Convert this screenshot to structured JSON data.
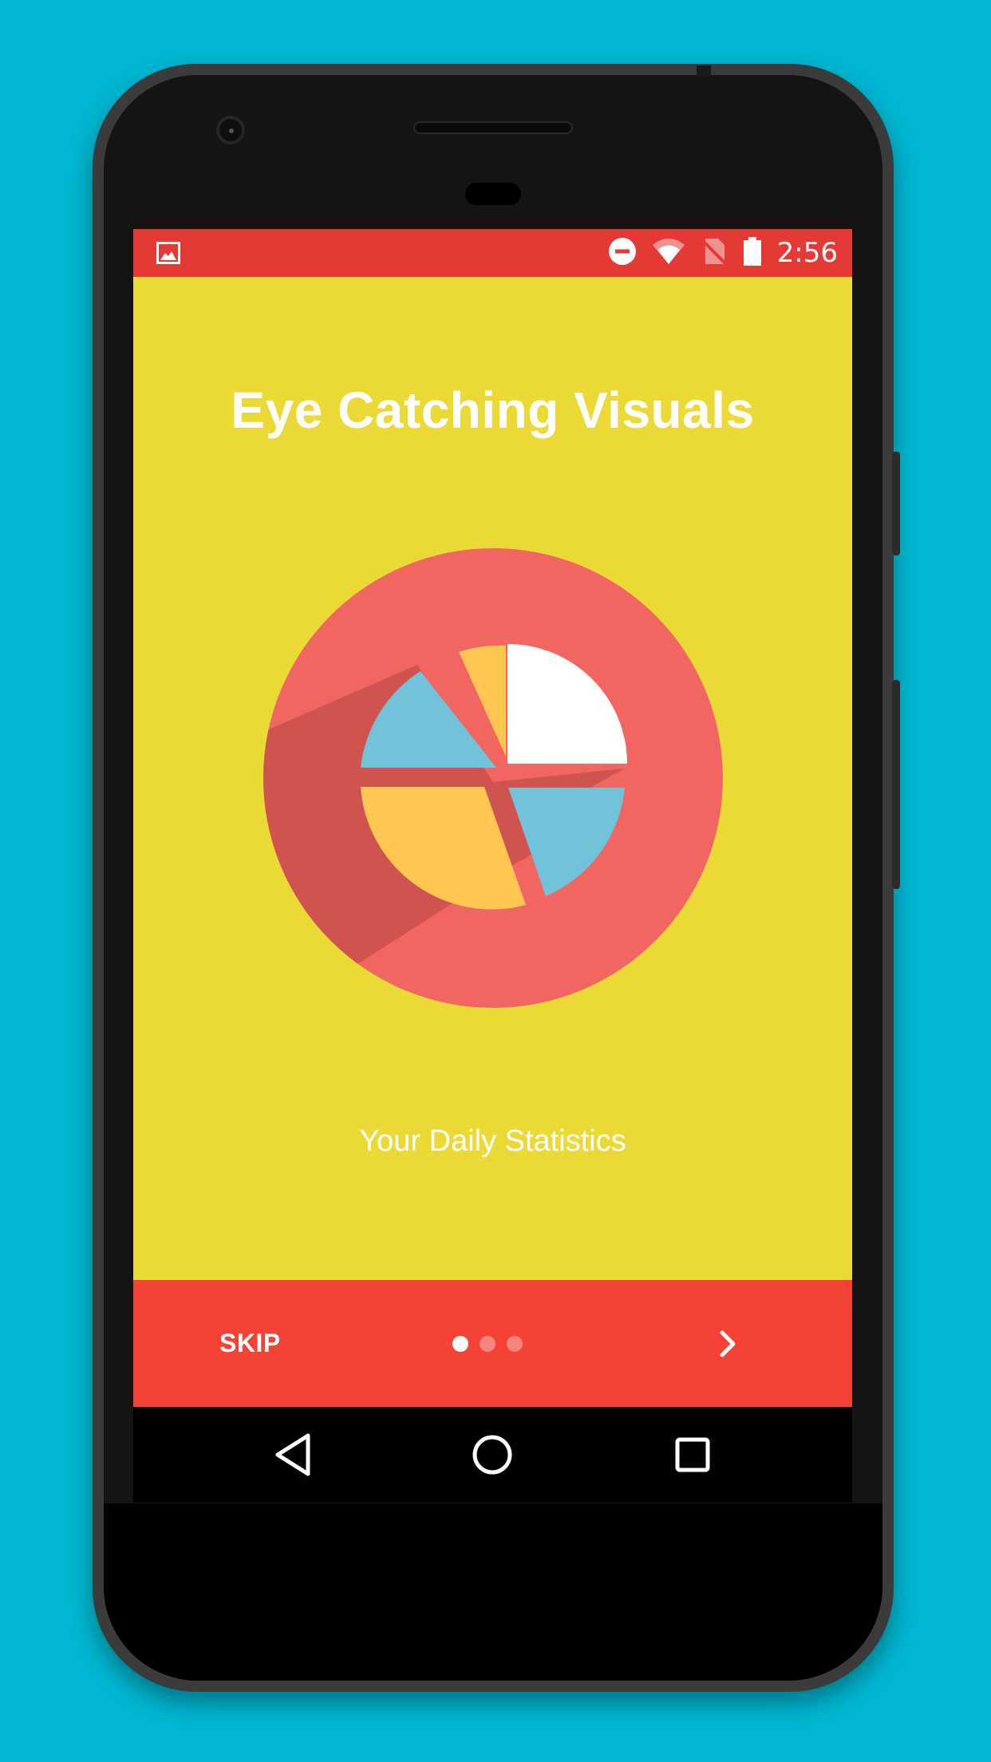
{
  "status_bar": {
    "time": "2:56",
    "left_icon": "image-icon",
    "right_icons": [
      "do-not-disturb-icon",
      "wifi-icon",
      "no-sim-icon",
      "battery-icon"
    ]
  },
  "onboarding": {
    "title": "Eye Catching Visuals",
    "subtitle": "Your Daily Statistics",
    "illustration": "pie-chart-icon",
    "page_count": 3,
    "current_page": 1
  },
  "controls": {
    "skip_label": "SKIP",
    "next_icon": "chevron-right-icon"
  },
  "nav_bar": {
    "back_icon": "back-triangle-icon",
    "home_icon": "home-circle-icon",
    "recents_icon": "recents-square-icon"
  },
  "colors": {
    "background": "#00B7D1",
    "screen": "#EBD935",
    "status_bar": "#E53935",
    "bottom_bar": "#F44336",
    "circle": "#F26661",
    "pie_blue": "#72C3D9",
    "pie_yellow": "#FFC651",
    "pie_white": "#FFFFFF"
  }
}
